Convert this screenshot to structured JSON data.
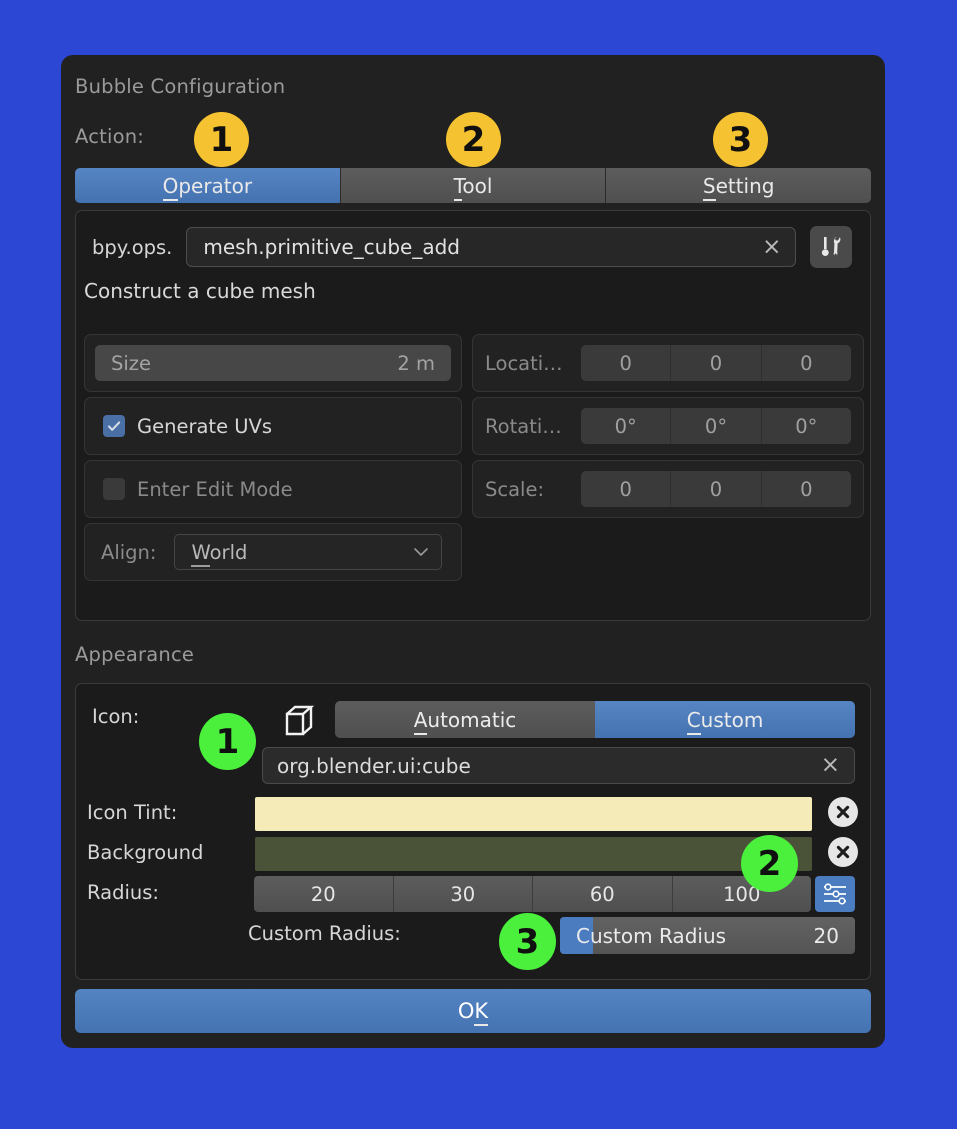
{
  "colors": {
    "page_background": "#2b47d4",
    "dialog_background": "#212121",
    "accent_blue": "#4a7cbf",
    "badge_yellow": "#f5c231",
    "badge_green": "#4bf03c",
    "icon_tint_swatch": "#f5ebb8",
    "background_swatch": "#4a5338"
  },
  "dialog": {
    "title": "Bubble Configuration",
    "action_label": "Action:",
    "tabs": [
      {
        "label": "Operator",
        "accel": "O",
        "active": true
      },
      {
        "label": "Tool",
        "accel": "T",
        "active": false
      },
      {
        "label": "Setting",
        "accel": "S",
        "active": false
      }
    ]
  },
  "operator": {
    "prefix_label": "bpy.ops.",
    "operator_value": "mesh.primitive_cube_add",
    "clear_glyph": "×",
    "description": "Construct a cube mesh",
    "left_fields": {
      "size": {
        "label": "Size",
        "value": "2 m"
      },
      "generate_uvs": {
        "label": "Generate UVs",
        "checked": true
      },
      "enter_edit_mode": {
        "label": "Enter Edit Mode",
        "checked": false
      },
      "align": {
        "label": "Align:",
        "value": "World",
        "accel": "W"
      }
    },
    "right_fields": [
      {
        "label": "Locati…",
        "values": [
          "0",
          "0",
          "0"
        ]
      },
      {
        "label": "Rotati…",
        "values": [
          "0°",
          "0°",
          "0°"
        ]
      },
      {
        "label": "Scale:",
        "values": [
          "0",
          "0",
          "0"
        ]
      }
    ]
  },
  "appearance": {
    "section_label": "Appearance",
    "icon_label": "Icon:",
    "icon_mode": [
      {
        "label": "Automatic",
        "accel": "A",
        "active": false
      },
      {
        "label": "Custom",
        "accel": "C",
        "active": true
      }
    ],
    "icon_id_value": "org.blender.ui:cube",
    "icon_tint_label": "Icon Tint:",
    "background_label": "Background",
    "radius_label": "Radius:",
    "radius_options": [
      "20",
      "30",
      "60",
      "100"
    ],
    "custom_radius_label": "Custom Radius:",
    "custom_radius_slider_label": "Custom Radius",
    "custom_radius_value": "20"
  },
  "footer": {
    "ok_label_before": "O",
    "ok_accel": "K"
  },
  "annotations": {
    "yellow": [
      "1",
      "2",
      "3"
    ],
    "green": [
      "1",
      "2",
      "3"
    ]
  }
}
